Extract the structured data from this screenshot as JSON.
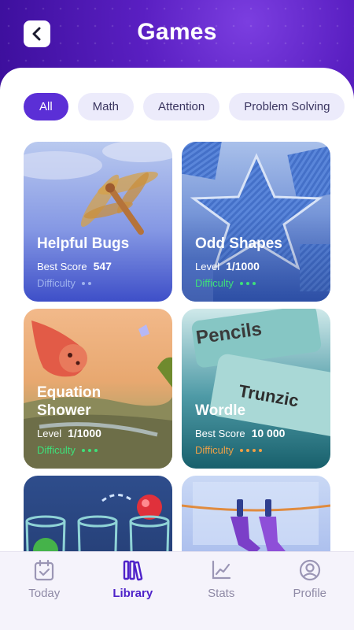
{
  "header": {
    "title": "Games"
  },
  "filters": [
    "All",
    "Math",
    "Attention",
    "Problem Solving"
  ],
  "cards": [
    {
      "name": "Helpful Bugs",
      "stat_label": "Best Score",
      "stat_value": "547",
      "difficulty_label": "Difficulty",
      "difficulty_dots": 2,
      "accent": "#9fb2ee"
    },
    {
      "name": "Odd Shapes",
      "stat_label": "Level",
      "stat_value": "1/1000",
      "difficulty_label": "Difficulty",
      "difficulty_dots": 3,
      "accent": "#3ee07a"
    },
    {
      "name": "Equation\nShower",
      "stat_label": "Level",
      "stat_value": "1/1000",
      "difficulty_label": "Difficulty",
      "difficulty_dots": 3,
      "accent": "#3ee07a",
      "art_text": []
    },
    {
      "name": "Wordle",
      "stat_label": "Best Score",
      "stat_value": "10 000",
      "difficulty_label": "Difficulty",
      "difficulty_dots": 4,
      "accent": "#f0a045",
      "art_text": [
        "Pencils",
        "Trunzic"
      ]
    },
    {
      "name": "",
      "stat_label": "",
      "stat_value": ""
    },
    {
      "name": "",
      "stat_label": "",
      "stat_value": ""
    }
  ],
  "tabbar": [
    {
      "label": "Today",
      "icon": "calendar-check-icon"
    },
    {
      "label": "Library",
      "icon": "library-icon"
    },
    {
      "label": "Stats",
      "icon": "chart-icon"
    },
    {
      "label": "Profile",
      "icon": "user-icon"
    }
  ]
}
